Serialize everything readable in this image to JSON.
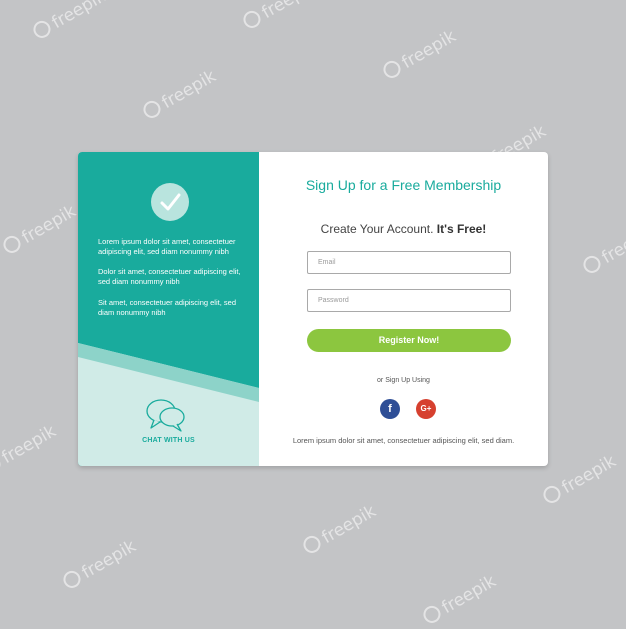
{
  "watermark": {
    "text": "freepik"
  },
  "left_panel": {
    "paragraphs": [
      "Lorem ipsum dolor sit amet, consectetuer adipiscing elit, sed diam nonummy nibh",
      "Dolor sit amet, consectetuer adipiscing elit, sed diam nonummy nibh",
      "Sit amet, consectetuer adipiscing elit, sed diam nonummy nibh"
    ],
    "chat_label": "CHAT WITH US",
    "icons": {
      "check": "checkmark-icon",
      "chat": "chat-bubbles-icon"
    }
  },
  "form": {
    "title": "Sign Up for a Free Membership",
    "subtitle_regular": "Create Your Account.",
    "subtitle_bold": "It's Free!",
    "email_placeholder": "Email",
    "password_placeholder": "Password",
    "register_label": "Register Now!",
    "or_label": "or Sign Up Using",
    "facebook_glyph": "f",
    "google_glyph": "G+",
    "footer": "Lorem ipsum dolor sit amet, consectetuer adipiscing elit, sed diam."
  },
  "colors": {
    "background": "#c3c4c6",
    "teal": "#19ab9d",
    "light_teal": "#b9e4de",
    "green_button": "#8cc63f",
    "facebook": "#2e4e96",
    "google": "#d6402f"
  }
}
